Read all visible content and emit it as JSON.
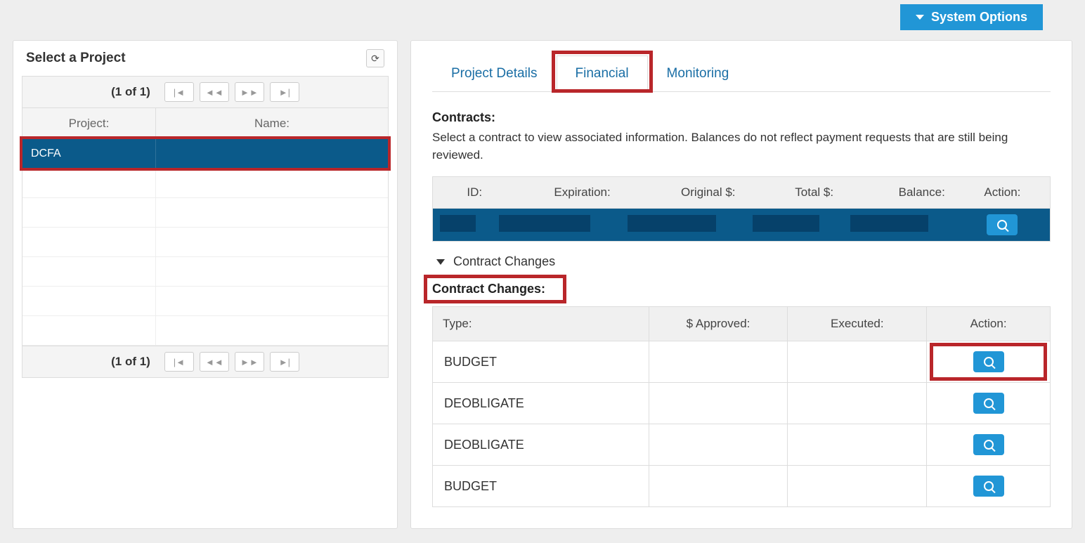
{
  "topbar": {
    "system_options": "System Options"
  },
  "left": {
    "title": "Select a Project",
    "pager": "(1 of 1)",
    "headers": {
      "project": "Project:",
      "name": "Name:"
    },
    "rows": [
      {
        "project": "DCFA",
        "name": "",
        "selected": true
      },
      {
        "project": "",
        "name": ""
      },
      {
        "project": "",
        "name": ""
      },
      {
        "project": "",
        "name": ""
      },
      {
        "project": "",
        "name": ""
      },
      {
        "project": "",
        "name": ""
      },
      {
        "project": "",
        "name": ""
      }
    ]
  },
  "tabs": {
    "project_details": "Project Details",
    "financial": "Financial",
    "monitoring": "Monitoring",
    "active": "financial"
  },
  "contracts": {
    "title": "Contracts:",
    "desc": "Select a contract to view associated information. Balances do not reflect payment requests that are still being reviewed.",
    "headers": {
      "id": "ID:",
      "expiration": "Expiration:",
      "original": "Original $:",
      "total": "Total $:",
      "balance": "Balance:",
      "action": "Action:"
    }
  },
  "contract_changes": {
    "toggle": "Contract Changes",
    "title": "Contract Changes:",
    "headers": {
      "type": "Type:",
      "approved": "$ Approved:",
      "executed": "Executed:",
      "action": "Action:"
    },
    "rows": [
      {
        "type": "BUDGET",
        "approved": "",
        "executed": ""
      },
      {
        "type": "DEOBLIGATE",
        "approved": "",
        "executed": ""
      },
      {
        "type": "DEOBLIGATE",
        "approved": "",
        "executed": ""
      },
      {
        "type": "BUDGET",
        "approved": "",
        "executed": ""
      }
    ]
  }
}
